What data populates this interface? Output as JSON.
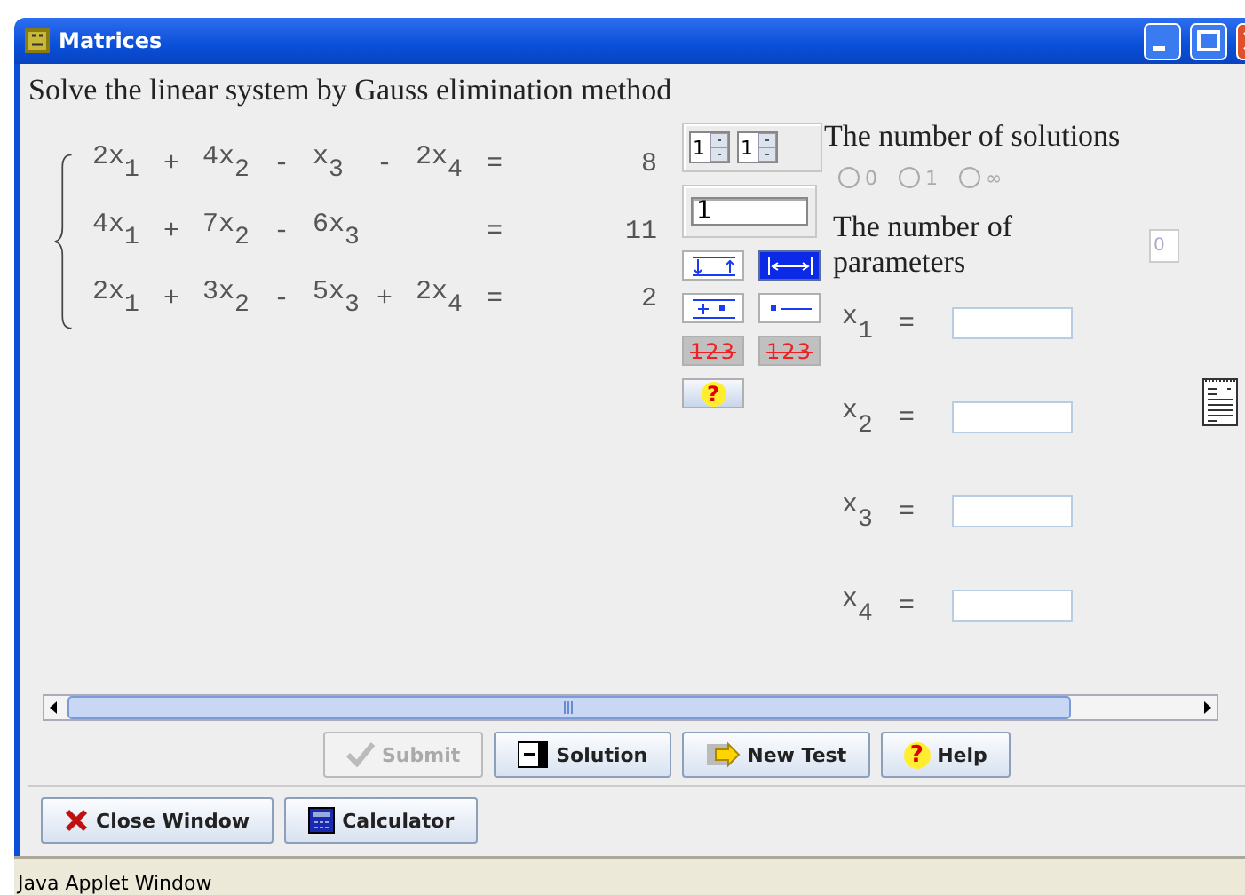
{
  "window": {
    "title": "Matrices"
  },
  "instruction": "Solve the linear system by Gauss elimination method",
  "equations": [
    {
      "parts": [
        "2x$_{1}$",
        "+",
        "4x$_{2}$",
        "-",
        "x$_{3}$",
        "-",
        "2x$_{4}$"
      ],
      "equals": "=",
      "rhs": "8"
    },
    {
      "parts": [
        "4x$_{1}$",
        "+",
        "7x$_{2}$",
        "-",
        "6x$_{3}$"
      ],
      "equals": "=",
      "rhs": "11"
    },
    {
      "parts": [
        "2x$_{1}$",
        "+",
        "3x$_{2}$",
        "-",
        "5x$_{3}$",
        "+",
        "2x$_{4}$"
      ],
      "equals": "=",
      "rhs": "2"
    }
  ],
  "tools": {
    "spinners": [
      "1",
      "1"
    ],
    "factor": "1",
    "buttons": [
      {
        "kind": "swap",
        "selected": false
      },
      {
        "kind": "move",
        "selected": true
      },
      {
        "kind": "add",
        "selected": false
      },
      {
        "kind": "scale",
        "selected": false
      },
      {
        "kind": "strike",
        "label": "123",
        "selected": false
      },
      {
        "kind": "cross",
        "label": "123",
        "selected": false
      },
      {
        "kind": "help",
        "label": "?",
        "selected": false
      }
    ]
  },
  "solutions": {
    "title": "The number of solutions",
    "options": [
      {
        "label": "0",
        "selected": false,
        "disabled": true
      },
      {
        "label": "1",
        "selected": false,
        "disabled": true
      },
      {
        "label": "∞",
        "selected": false,
        "disabled": true
      }
    ]
  },
  "parameters": {
    "label": "The number of parameters",
    "value": "0",
    "disabled": true
  },
  "unknowns": [
    {
      "name": "x$_{1}$",
      "equals": "="
    },
    {
      "name": "x$_{2}$",
      "equals": "="
    },
    {
      "name": "x$_{3}$",
      "equals": "="
    },
    {
      "name": "x$_{4}$",
      "equals": "="
    }
  ],
  "actions": [
    {
      "kind": "submit",
      "label": "Submit",
      "disabled": true
    },
    {
      "kind": "solution",
      "label": "Solution",
      "disabled": false
    },
    {
      "kind": "newtest",
      "label": "New Test",
      "disabled": false
    },
    {
      "kind": "help",
      "label": "Help",
      "icon_text": "?",
      "disabled": false
    }
  ],
  "footer_buttons": [
    {
      "kind": "close",
      "label": "Close Window"
    },
    {
      "kind": "calculator",
      "label": "Calculator"
    }
  ],
  "status_bar": "Java Applet Window"
}
